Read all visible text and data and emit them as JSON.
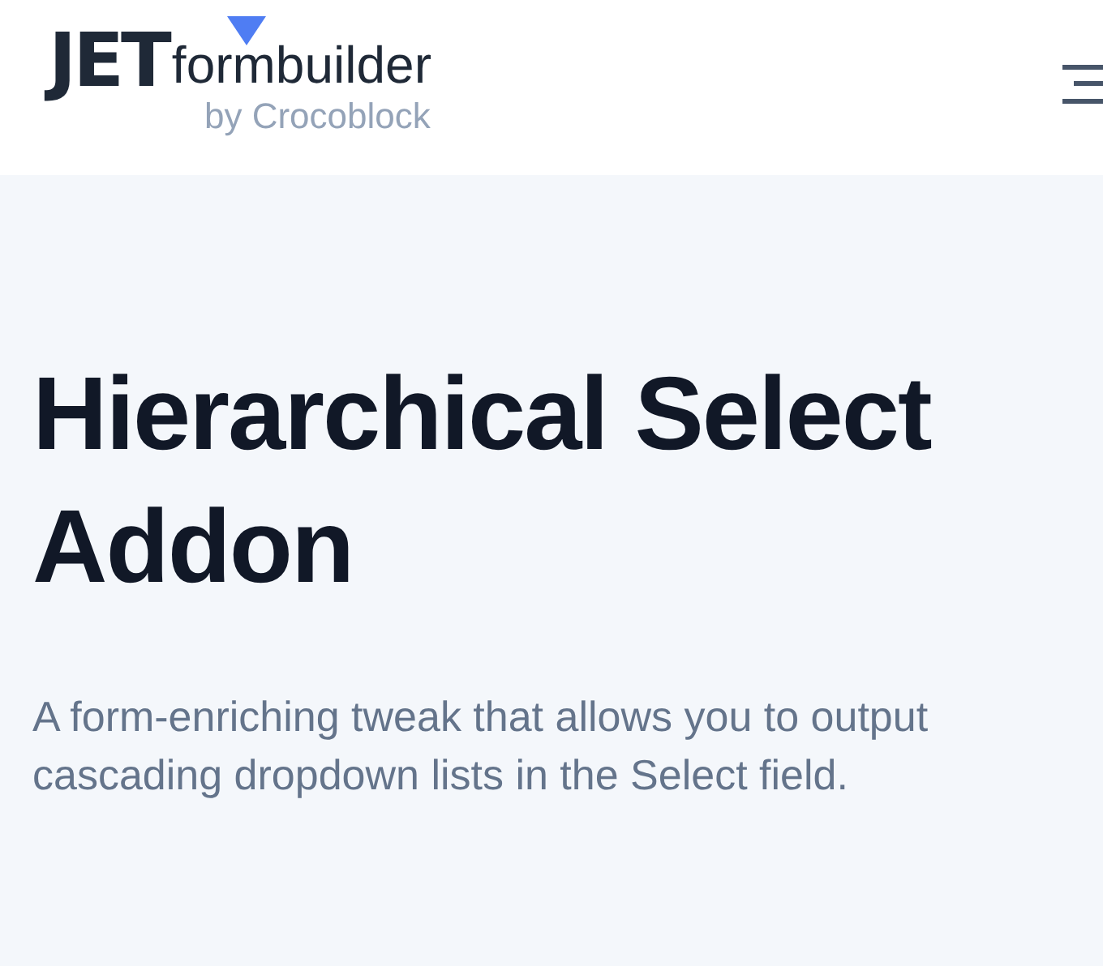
{
  "header": {
    "logo": {
      "mark": "JET",
      "name": "formbuilder",
      "byline": "by Crocoblock"
    }
  },
  "hero": {
    "title": "Hierarchical Select Addon",
    "description": "A form-enriching tweak that allows you to output cascading dropdown lists in the Select field."
  }
}
